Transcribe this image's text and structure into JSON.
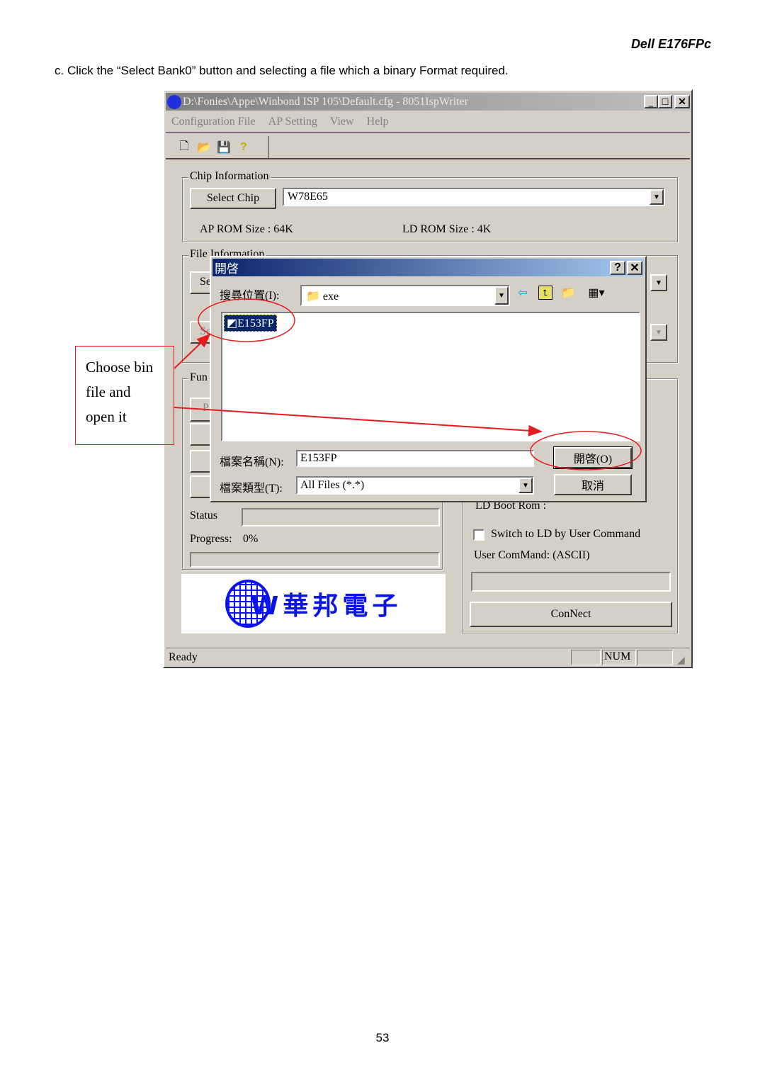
{
  "header": {
    "model": "Dell E176FPc"
  },
  "instruction": "c. Click the “Select Bank0” button and selecting a file which a binary Format required.",
  "window": {
    "title": "D:\\Fonies\\Appe\\Winbond ISP 105\\Default.cfg - 8051IspWriter",
    "menu": [
      "Configuration File",
      "AP Setting",
      "View",
      "Help"
    ],
    "toolbar_icons": [
      "new-file-icon",
      "open-folder-icon",
      "save-icon",
      "help-icon"
    ],
    "chip_info": {
      "label": "Chip Information",
      "select_chip": "Select Chip",
      "chip_value": "W78E65",
      "ap_rom": "AP ROM Size : 64K",
      "ld_rom": "LD ROM Size : 4K"
    },
    "file_info": {
      "label": "File Information",
      "button1": "Se",
      "button2": "Se"
    },
    "function": {
      "label": "Fun",
      "button1": "P"
    },
    "ld_boot_rom": "LD Boot Rom :",
    "status_label": "Status",
    "progress_label": "Progress:",
    "progress_value": "0%",
    "progress_fraction": 0,
    "switch_ld": "Switch to LD by User Command",
    "switch_ld_checked": false,
    "user_command": "User ComMand:  (ASCII)",
    "connect": "ConNect",
    "logo_text": "W華邦電子",
    "statusbar": {
      "text": "Ready",
      "num": "NUM"
    }
  },
  "dialog": {
    "title": "開啓",
    "look_in_label": "搜尋位置(I):",
    "look_in_value": "exe",
    "files": [
      "E153FP"
    ],
    "filename_label": "檔案名稱(N):",
    "filename_value": "E153FP",
    "filetype_label": "檔案類型(T):",
    "filetype_value": "All Files (*.*)",
    "open": "開啓(O)",
    "cancel": "取消"
  },
  "annotation": {
    "text_lines": [
      "Choose bin",
      "file and",
      "open it"
    ],
    "color": "#e8191f"
  },
  "footer": {
    "page": "53"
  }
}
